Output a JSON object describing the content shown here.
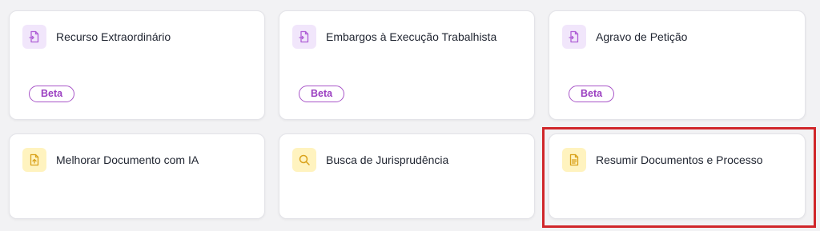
{
  "cards": [
    {
      "title": "Recurso Extraordinário",
      "icon": "document-upload-icon",
      "badge": "Beta",
      "color": "purple"
    },
    {
      "title": "Embargos à Execução Trabalhista",
      "icon": "document-upload-icon",
      "badge": "Beta",
      "color": "purple"
    },
    {
      "title": "Agravo de Petição",
      "icon": "document-upload-icon",
      "badge": "Beta",
      "color": "purple"
    },
    {
      "title": "Melhorar Documento com IA",
      "icon": "document-improve-icon",
      "color": "yellow"
    },
    {
      "title": "Busca de Jurisprudência",
      "icon": "search-icon",
      "color": "yellow"
    },
    {
      "title": "Resumir Documentos e Processo",
      "icon": "document-text-icon",
      "color": "yellow"
    }
  ],
  "colors": {
    "purple_icon": "#b05fd6",
    "yellow_icon": "#d9a21b",
    "badge_border": "#a855c8",
    "highlight": "#d0262a"
  }
}
